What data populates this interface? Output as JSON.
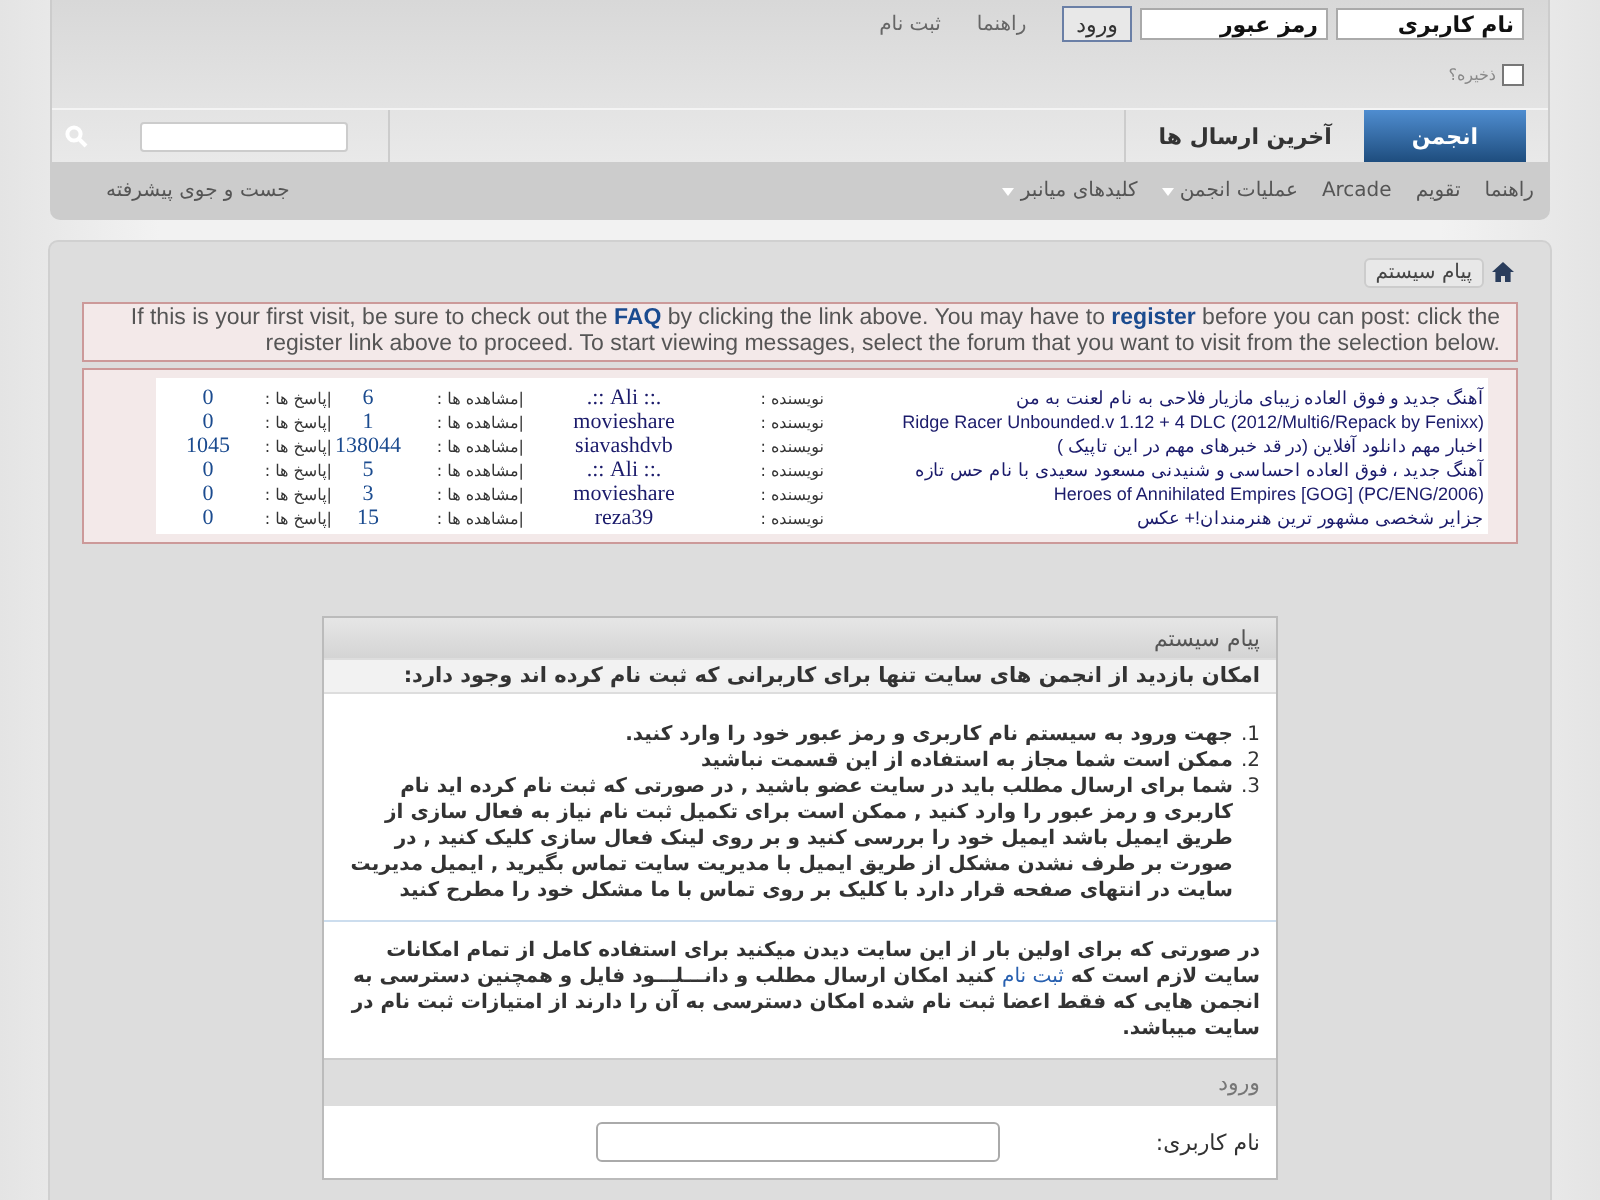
{
  "header": {
    "login": {
      "username_placeholder": "نام کاربری",
      "password_placeholder": "رمز عبور",
      "login_button": "ورود",
      "remember": {
        "label": "ذخیره؟",
        "checked": false
      }
    },
    "links": [
      "راهنما",
      "ثبت نام"
    ]
  },
  "tabs": [
    {
      "label": "انجمن",
      "selected": true
    },
    {
      "label": "آخرین ارسال ها",
      "selected": false
    }
  ],
  "subnav": {
    "items": [
      {
        "label": "راهنما",
        "dropdown": false
      },
      {
        "label": "تقویم",
        "dropdown": false
      },
      {
        "label": "Arcade",
        "dropdown": false
      },
      {
        "label": "عملیات انجمن",
        "dropdown": true
      },
      {
        "label": "کلیدهای میانبر",
        "dropdown": true
      }
    ],
    "advanced_search": "جست و جوی پیشرفته"
  },
  "breadcrumb": "پیام سیستم",
  "notice": {
    "text_1": "If this is your first visit, be sure to check out the",
    "faq_link": "FAQ",
    "text_2": "by clicking the link above. You may have to",
    "register_link": "register",
    "text_3": "before you can post: click the register link above to proceed. To start viewing messages, select the forum that you want to visit from the selection below."
  },
  "ticker": {
    "rows": [
      {
        "title": "آهنگ جدید و فوق العاده زیبای مازیار فلاحی به نام لعنت به من",
        "author_label": "نویسنده :",
        "author": ".:: Ali ::.",
        "views_label": "|مشاهده ها :",
        "views": "6",
        "replies_label": "|پاسخ ها :",
        "replies": "0"
      },
      {
        "title": "(Ridge Racer Unbounded.v 1.12 + 4 DLC (2012/Multi6/Repack by Fenixx",
        "author_label": "نویسنده :",
        "author": "movieshare",
        "views_label": "|مشاهده ها :",
        "views": "1",
        "replies_label": "|پاسخ ها :",
        "replies": "0"
      },
      {
        "title": "اخبار مهم دانلود آفلاین (در قد خبرهای مهم در این تاپیک )",
        "author_label": "نویسنده :",
        "author": "siavashdvb",
        "views_label": "|مشاهده ها :",
        "views": "138044",
        "replies_label": "|پاسخ ها :",
        "replies": "1045"
      },
      {
        "title": "آهنگ جدید ، فوق العاده احساسی و شنیدنی مسعود سعیدی با نام حس تازه",
        "author_label": "نویسنده :",
        "author": ".:: Ali ::.",
        "views_label": "|مشاهده ها :",
        "views": "5",
        "replies_label": "|پاسخ ها :",
        "replies": "0"
      },
      {
        "title": "(Heroes of Annihilated Empires [GOG] (PC/ENG/2006",
        "author_label": "نویسنده :",
        "author": "movieshare",
        "views_label": "|مشاهده ها :",
        "views": "3",
        "replies_label": "|پاسخ ها :",
        "replies": "0"
      },
      {
        "title": "جزایر شخصی مشهور ترین هنرمندان!+ عکس",
        "author_label": "نویسنده :",
        "author": "reza39",
        "views_label": "|مشاهده ها :",
        "views": "15",
        "replies_label": "|پاسخ ها :",
        "replies": "0"
      }
    ]
  },
  "message": {
    "title": "پیام سیستم",
    "heading": "امکان بازدید از انجمن های سایت تنها برای کاربرانی که ثبت نام کرده اند وجود دارد:",
    "items": [
      {
        "marker": "1.",
        "text": "جهت ورود به سیستم نام کاربری و رمز عبور خود را وارد کنید."
      },
      {
        "marker": "2.",
        "text": "ممکن است شما مجاز به استفاده از این قسمت نباشید"
      },
      {
        "marker": "3.",
        "text": "شما برای ارسال مطلب باید در سایت عضو باشید , در صورتی که ثبت نام کرده اید نام کاربری و رمز عبور را وارد کنید , ممکن است برای تکمیل ثبت نام نیاز به فعال سازی از طریق ایمیل باشد ایمیل خود را بررسی کنید و بر روی لینک فعال سازی کلیک کنید , در صورت بر طرف نشدن مشکل از طریق ایمیل با مدیریت سایت تماس بگیرید , ایمیل مدیریت سایت در انتهای صفحه قرار دارد با کلیک بر روی تماس با ما مشکل خود را مطرح کنید"
      }
    ],
    "paragraph": [
      {
        "text": "در صورتی که برای اولین بار از این سایت دیدن میکنید برای استفاده کامل از تمام امکانات سایت لازم است که ",
        "link": false
      },
      {
        "text": "ثبت نام",
        "link": true
      },
      {
        "text": " کنید امکان ارسال مطلب و دانـــلـــود فایل و همچنین دسترسی به انجمن هایی که فقط اعضا ثبت نام شده امکان دسترسی به آن را دارند از امتیازات ثبت نام در سایت میباشد.",
        "link": false
      }
    ],
    "login_title": "ورود",
    "username_label": "نام کاربری:"
  }
}
